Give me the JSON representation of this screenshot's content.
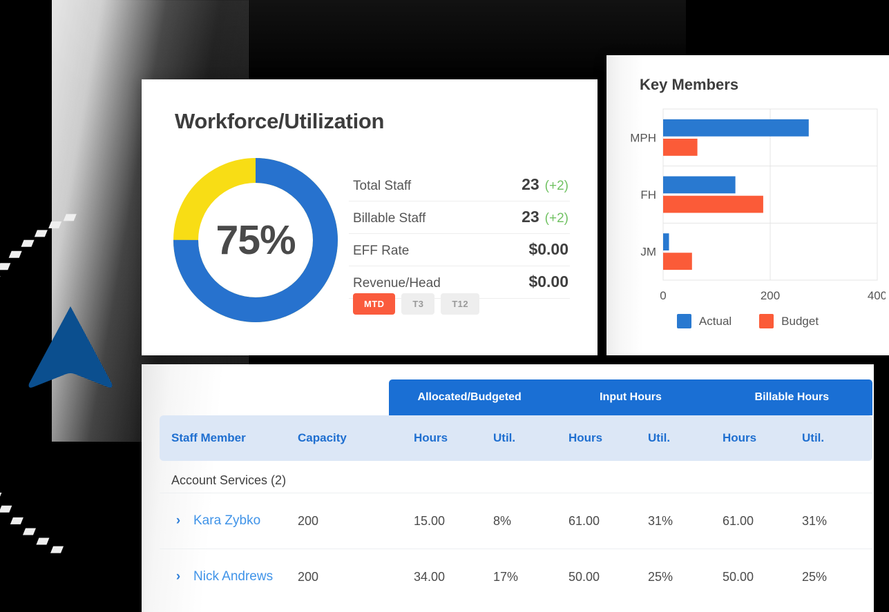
{
  "background": {
    "arrow_color": "#0b4f8f",
    "dot_color": "#efefef"
  },
  "workforce_card": {
    "title": "Workforce/Utilization",
    "donut": {
      "center_label": "75%",
      "filled_percent": 75,
      "remainder_percent": 25,
      "filled_color": "#2772ce",
      "remainder_color": "#f8dd15"
    },
    "stats": [
      {
        "label": "Total Staff",
        "value": "23",
        "delta": "(+2)"
      },
      {
        "label": "Billable Staff",
        "value": "23",
        "delta": "(+2)"
      },
      {
        "label": "EFF Rate",
        "value": "$0.00",
        "delta": ""
      },
      {
        "label": "Revenue/Head",
        "value": "$0.00",
        "delta": ""
      }
    ],
    "delta_color": "#71c263",
    "segments": [
      {
        "label": "MTD",
        "active": true
      },
      {
        "label": "T3",
        "active": false
      },
      {
        "label": "T12",
        "active": false
      }
    ],
    "segment_active_color": "#fa5b3d"
  },
  "key_members_card": {
    "title": "Key Members",
    "legend": [
      {
        "label": "Actual",
        "color": "#2979d0"
      },
      {
        "label": "Budget",
        "color": "#fb5b38"
      }
    ]
  },
  "chart_data": {
    "type": "bar",
    "orientation": "horizontal",
    "title": "Key Members",
    "categories": [
      "MPH",
      "FH",
      "JM"
    ],
    "series": [
      {
        "name": "Actual",
        "color": "#2979d0",
        "values": [
          272,
          135,
          11
        ]
      },
      {
        "name": "Budget",
        "color": "#fb5b38",
        "values": [
          64,
          187,
          54
        ]
      }
    ],
    "xlabel": "",
    "ylabel": "",
    "xlim": [
      0,
      400
    ],
    "xticks": [
      0,
      200,
      400
    ],
    "xtick_labels": [
      "0",
      "200",
      "400"
    ],
    "grid": true,
    "legend_position": "bottom"
  },
  "table_card": {
    "group_headers": [
      "Allocated/Budgeted",
      "Input Hours",
      "Billable Hours"
    ],
    "columns": [
      "Staff Member",
      "Capacity",
      "Hours",
      "Util.",
      "Hours",
      "Util.",
      "Hours",
      "Util."
    ],
    "group_label": "Account Services (2)",
    "rows": [
      {
        "chevron": "›",
        "name": "Kara Zybko",
        "capacity": "200",
        "alloc_hours": "15.00",
        "alloc_util": "8%",
        "input_hours": "61.00",
        "input_util": "31%",
        "billable_hours": "61.00",
        "billable_util": "31%"
      },
      {
        "chevron": "›",
        "name": "Nick Andrews",
        "capacity": "200",
        "alloc_hours": "34.00",
        "alloc_util": "17%",
        "input_hours": "50.00",
        "input_util": "25%",
        "billable_hours": "50.00",
        "billable_util": "25%"
      }
    ]
  }
}
